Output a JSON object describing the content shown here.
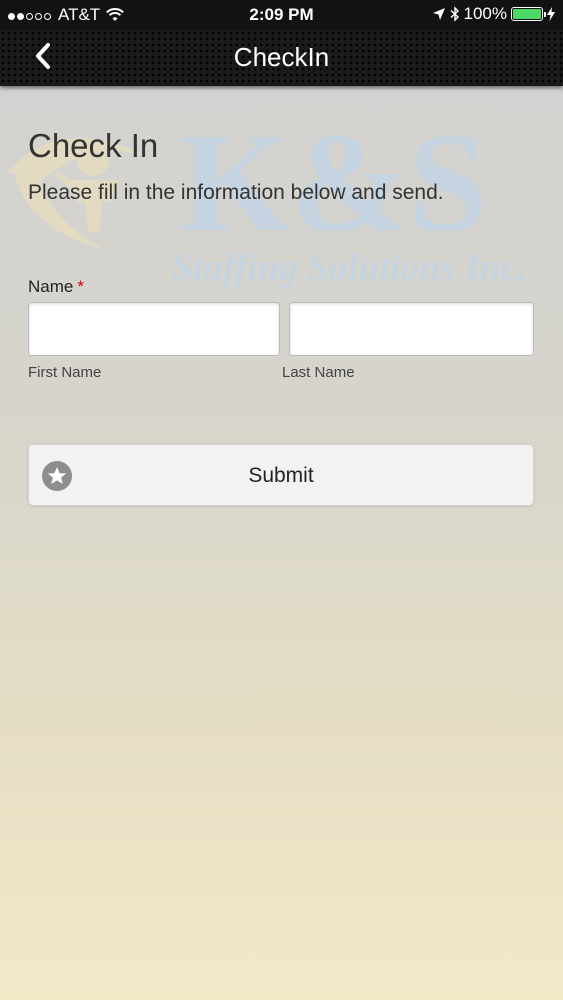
{
  "status_bar": {
    "carrier": "AT&T",
    "time": "2:09 PM",
    "battery_percent": "100%",
    "battery_level": 1.0,
    "signal_bars": 2,
    "signal_total": 5
  },
  "nav": {
    "title": "CheckIn",
    "back_icon": "chevron-left-icon"
  },
  "logo": {
    "main_text": "K&S",
    "tagline": "Staffing Solutions Inc."
  },
  "form": {
    "title": "Check In",
    "subtitle": "Please fill in the information below and send.",
    "name_label": "Name",
    "required_marker": "*",
    "first_name": {
      "value": "",
      "sublabel": "First Name"
    },
    "last_name": {
      "value": "",
      "sublabel": "Last Name"
    },
    "submit_label": "Submit",
    "submit_icon": "star-icon"
  },
  "colors": {
    "required": "#dd0000",
    "battery": "#4cd964",
    "navbar": "#1a1a1a"
  }
}
